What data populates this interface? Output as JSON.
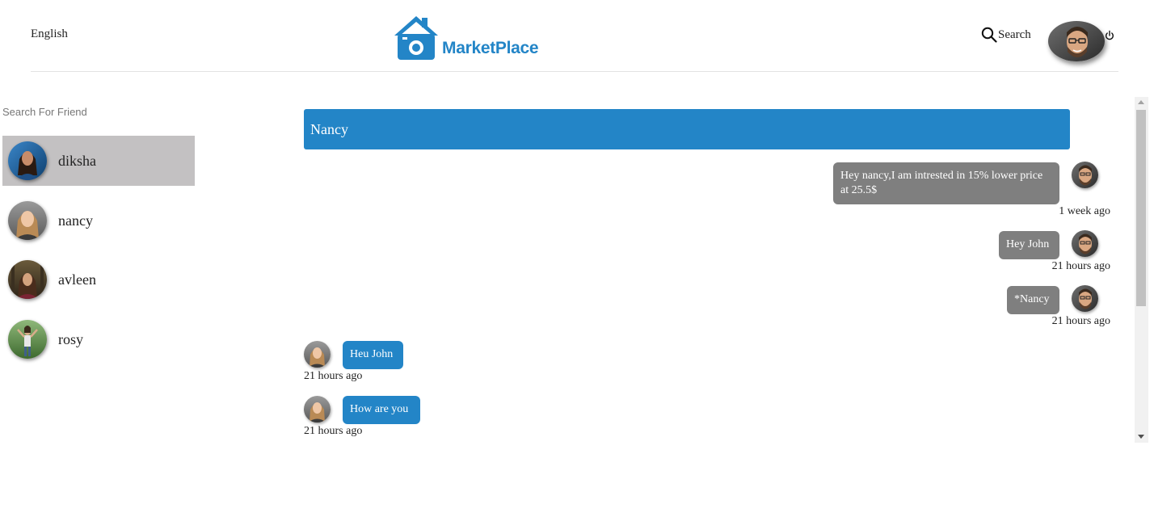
{
  "header": {
    "language": "English",
    "logo_text": "MarketPlace",
    "search_label": "Search"
  },
  "sidebar": {
    "search_placeholder": "Search For Friend",
    "friends": [
      {
        "name": "diksha",
        "active": true
      },
      {
        "name": "nancy",
        "active": false
      },
      {
        "name": "avleen",
        "active": false
      },
      {
        "name": "rosy",
        "active": false
      }
    ]
  },
  "chat": {
    "title": "Nancy",
    "messages": [
      {
        "direction": "sent",
        "text": "Hey nancy,I am intrested in 15% lower price at 25.5$",
        "time": "1 week ago"
      },
      {
        "direction": "sent",
        "text": "Hey John",
        "time": "21 hours ago"
      },
      {
        "direction": "sent",
        "text": "*Nancy",
        "time": "21 hours ago"
      },
      {
        "direction": "received",
        "text": "Heu John",
        "time": "21 hours ago"
      },
      {
        "direction": "received",
        "text": "How are you",
        "time": "21 hours ago"
      }
    ]
  },
  "colors": {
    "brand": "#2385c7",
    "sent_bubble": "#7f7f7f",
    "active_friend": "#c3c1c2"
  },
  "icons": {
    "logo": "house-camera-icon",
    "search": "search-icon",
    "power": "power-icon"
  }
}
